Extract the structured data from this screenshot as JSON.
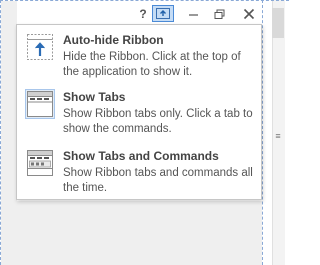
{
  "titlebar": {
    "help_label": "?",
    "minimize_label": "—",
    "close_label": "✕"
  },
  "menu": {
    "items": [
      {
        "title": "Auto-hide Ribbon",
        "description": "Hide the Ribbon. Click at the top of the application to show it.",
        "icon": "auto-hide-ribbon-icon",
        "selected": false
      },
      {
        "title": "Show Tabs",
        "description": "Show Ribbon tabs only. Click a tab to show the commands.",
        "icon": "show-tabs-icon",
        "selected": true
      },
      {
        "title": "Show Tabs and Commands",
        "description": "Show Ribbon tabs and commands all the time.",
        "icon": "show-tabs-and-commands-icon",
        "selected": false
      }
    ]
  },
  "colors": {
    "accent": "#2b78c8",
    "selected_fill": "#e1ecf8",
    "selected_border": "#a8c6eb"
  }
}
